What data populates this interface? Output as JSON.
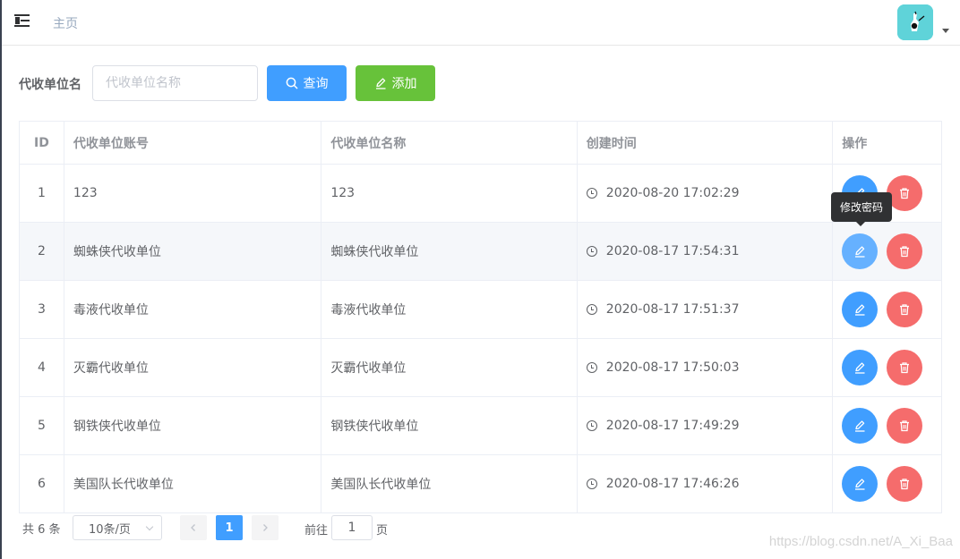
{
  "header": {
    "home_label": "主页"
  },
  "search": {
    "label": "代收单位名",
    "placeholder": "代收单位名称",
    "value": "",
    "query_button": "查询",
    "add_button": "添加"
  },
  "table": {
    "columns": [
      "ID",
      "代收单位账号",
      "代收单位名称",
      "创建时间",
      "操作"
    ],
    "rows": [
      {
        "id": "1",
        "account": "123",
        "name": "123",
        "created": "2020-08-20 17:02:29"
      },
      {
        "id": "2",
        "account": "蜘蛛侠代收单位",
        "name": "蜘蛛侠代收单位",
        "created": "2020-08-17 17:54:31"
      },
      {
        "id": "3",
        "account": "毒液代收单位",
        "name": "毒液代收单位",
        "created": "2020-08-17 17:51:37"
      },
      {
        "id": "4",
        "account": "灭霸代收单位",
        "name": "灭霸代收单位",
        "created": "2020-08-17 17:50:03"
      },
      {
        "id": "5",
        "account": "钢铁侠代收单位",
        "name": "钢铁侠代收单位",
        "created": "2020-08-17 17:49:29"
      },
      {
        "id": "6",
        "account": "美国队长代收单位",
        "name": "美国队长代收单位",
        "created": "2020-08-17 17:46:26"
      }
    ],
    "hover_row": 1
  },
  "tooltip": {
    "text": "修改密码"
  },
  "pagination": {
    "total": "共 6 条",
    "page_size": "10条/页",
    "current_page": "1",
    "goto_label": "前往",
    "goto_value": "1",
    "page_unit": "页"
  },
  "watermark": "https://blog.csdn.net/A_Xi_Baa",
  "colors": {
    "primary": "#409eff",
    "success": "#67c23a",
    "danger": "#f56c6c",
    "avatar_bg": "#5fd3d9"
  },
  "icons": {
    "menu": "indent-icon",
    "search": "search-icon",
    "add": "edit-icon",
    "clock": "clock-icon",
    "edit": "edit-icon",
    "delete": "trash-icon"
  }
}
